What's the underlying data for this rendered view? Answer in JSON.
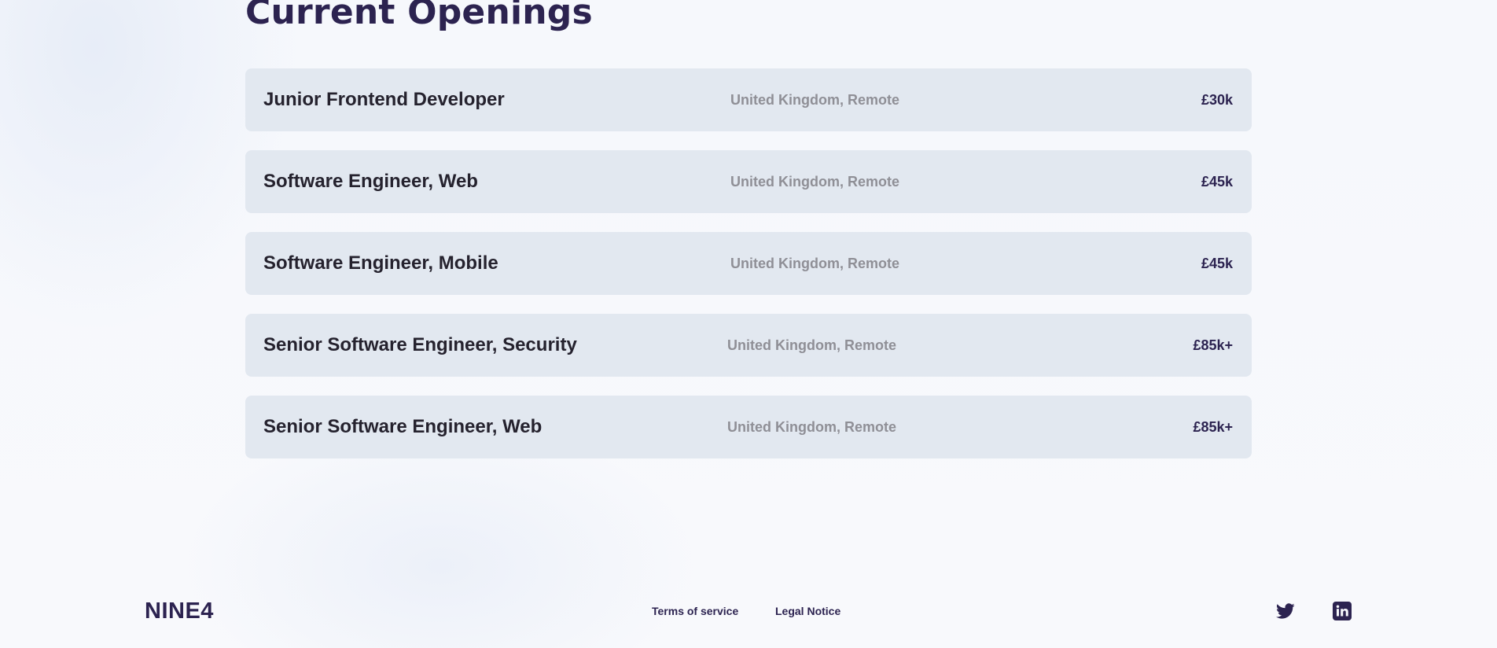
{
  "page": {
    "title": "Current Openings"
  },
  "openings": [
    {
      "title": "Junior Frontend Developer",
      "location": "United Kingdom, Remote",
      "salary": "£30k"
    },
    {
      "title": "Software Engineer, Web",
      "location": "United Kingdom, Remote",
      "salary": "£45k"
    },
    {
      "title": "Software Engineer, Mobile",
      "location": "United Kingdom, Remote",
      "salary": "£45k"
    },
    {
      "title": "Senior Software Engineer, Security",
      "location": "United Kingdom, Remote",
      "salary": "£85k+"
    },
    {
      "title": "Senior Software Engineer, Web",
      "location": "United Kingdom, Remote",
      "salary": "£85k+"
    }
  ],
  "footer": {
    "logo": "NINE4",
    "links": [
      "Terms of service",
      "Legal Notice"
    ],
    "social": [
      "twitter-icon",
      "linkedin-icon"
    ]
  },
  "colors": {
    "brand_text": "#2c2350",
    "row_background": "#e2e8f0",
    "location_text": "#8f8f96",
    "page_background": "#f7f8fc"
  }
}
